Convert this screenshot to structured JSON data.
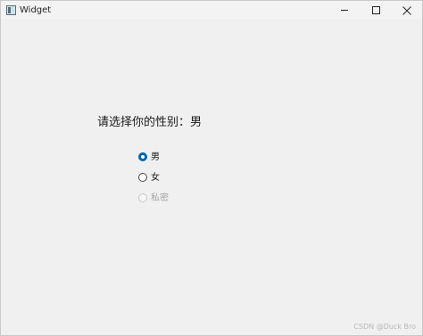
{
  "window": {
    "title": "Widget"
  },
  "question": {
    "prompt": "请选择你的性别：",
    "selected_value": "男"
  },
  "options": [
    {
      "label": "男",
      "checked": true,
      "enabled": true
    },
    {
      "label": "女",
      "checked": false,
      "enabled": true
    },
    {
      "label": "私密",
      "checked": false,
      "enabled": false
    }
  ],
  "watermark": "CSDN @Duck Bro",
  "colors": {
    "accent": "#0063b1",
    "window_bg": "#f0f0f0",
    "disabled_text": "#a5a5a5"
  }
}
